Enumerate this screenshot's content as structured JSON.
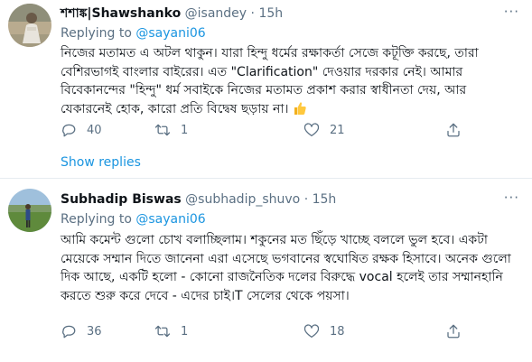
{
  "tweets": [
    {
      "display_name": "শশাঙ্ক|Shawshanko",
      "handle": "@isandey",
      "separator": "·",
      "time": "15h",
      "replying_prefix": "Replying to",
      "replying_to": "@sayani06",
      "text": "নিজের মতামত এ অটল থাকুন। যারা হিন্দু ধর্মের রক্ষাকর্তা সেজে কটূক্তি করছে, তারা বেশিরভাগই বাংলার বাইরের। এত \"Clarification\" দেওয়ার দরকার নেই। আমার বিবেকানন্দের \"হিন্দু\" ধর্ম সবাইকে নিজের মতামত প্রকাশ করার স্বাধীনতা দেয়, আর যেকারনেই হোক, কারো প্রতি বিদ্বেষ ছড়ায় না।",
      "emoji_icon": "thumbs-up-emoji",
      "reply_count": "40",
      "retweet_count": "1",
      "like_count": "21",
      "show_replies": "Show replies"
    },
    {
      "display_name": "Subhadip Biswas",
      "handle": "@subhadip_shuvo",
      "separator": "·",
      "time": "15h",
      "replying_prefix": "Replying to",
      "replying_to": "@sayani06",
      "text": "আমি কমেন্ট গুলো চোখ বলাচ্ছিলাম। শকুনের মত ছিঁড়ে খাচ্ছে বললে ভুল হবে। একটা মেয়েকে সম্মান দিতে জানেনা এরা এসেছে ভগবানের স্বঘোষিত রক্ষক হিসাবে। অনেক গুলো দিক আছে, একটি হলো - কোনো রাজনৈতিক দলের বিরুদ্ধে vocal হলেই তার সম্মানহানি করতে শুরু করে দেবে - এদের চাই।T সেলের থেকে পয়সা।",
      "reply_count": "36",
      "retweet_count": "1",
      "like_count": "18"
    }
  ],
  "colors": {
    "text": "#0f1419",
    "secondary": "#5b7083",
    "link": "#1b95e0",
    "divider": "#e6ecf0"
  }
}
